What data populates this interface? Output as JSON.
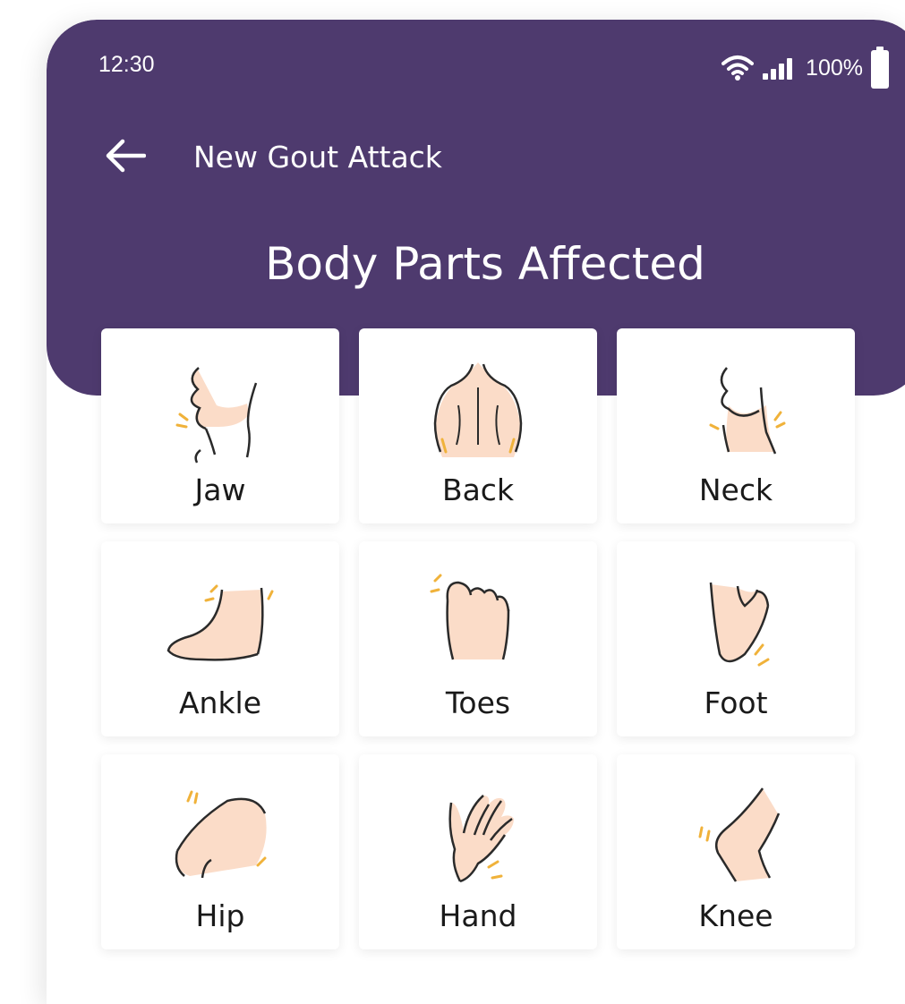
{
  "status_bar": {
    "time": "12:30",
    "battery": "100%"
  },
  "topbar": {
    "title": "New Gout Attack"
  },
  "page": {
    "heading": "Body Parts Affected"
  },
  "body_parts": [
    {
      "label": "Jaw",
      "icon": "jaw-icon"
    },
    {
      "label": "Back",
      "icon": "back-icon"
    },
    {
      "label": "Neck",
      "icon": "neck-icon"
    },
    {
      "label": "Ankle",
      "icon": "ankle-icon"
    },
    {
      "label": "Toes",
      "icon": "toes-icon"
    },
    {
      "label": "Foot",
      "icon": "foot-icon"
    },
    {
      "label": "Hip",
      "icon": "hip-icon"
    },
    {
      "label": "Hand",
      "icon": "hand-icon"
    },
    {
      "label": "Knee",
      "icon": "knee-icon"
    }
  ],
  "colors": {
    "header": "#4e3a6e",
    "skin": "#fbdcc8",
    "outline": "#2a2a2a",
    "pain": "#f0b23a"
  }
}
